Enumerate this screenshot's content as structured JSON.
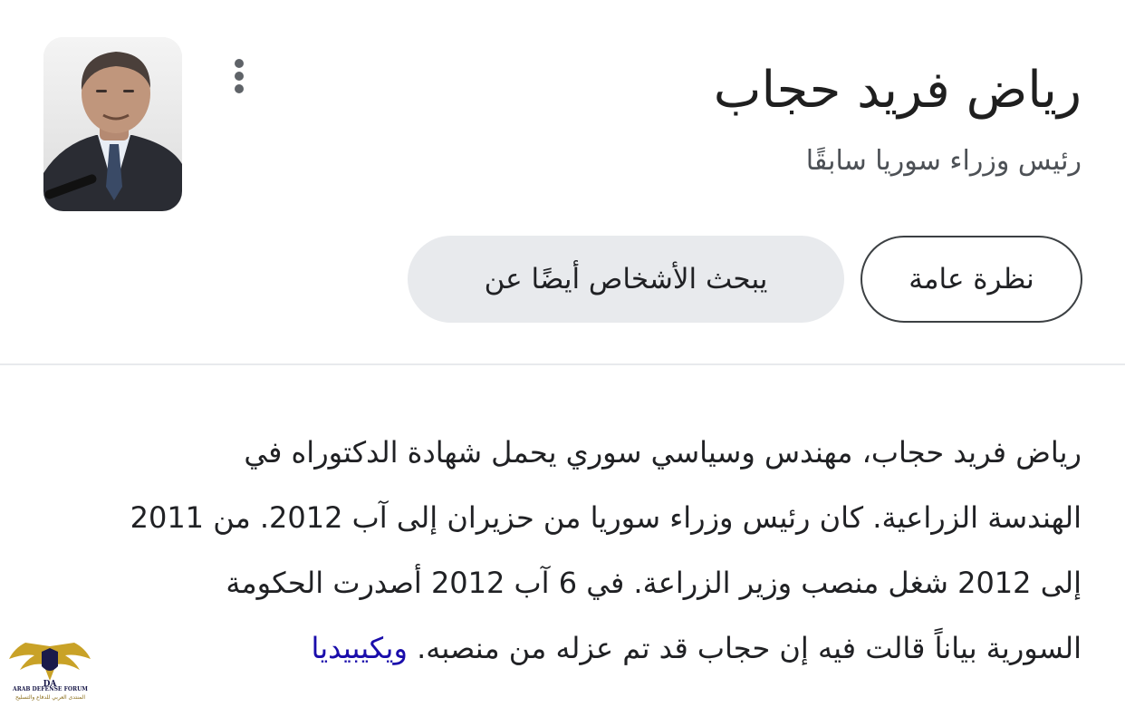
{
  "header": {
    "title": "رياض فريد حجاب",
    "subtitle": "رئيس وزراء سوريا سابقًا"
  },
  "tabs": [
    {
      "label": "نظرة عامة",
      "selected": true
    },
    {
      "label": "يبحث الأشخاص أيضًا عن",
      "selected": false
    }
  ],
  "description": {
    "lines": [
      "رياض فريد حجاب، مهندس وسياسي سوري يحمل شهادة الدكتوراه في",
      "الهندسة الزراعية. كان رئيس وزراء سوريا من حزيران إلى آب 2012. من 2011",
      "إلى 2012 شغل منصب وزير الزراعة. في 6 آب 2012 أصدرت الحكومة",
      "السورية بياناً قالت فيه إن حجاب قد تم عزله من منصبه."
    ],
    "source_link": "ويكيبيديا"
  },
  "watermark": {
    "abbr": "DA",
    "name": "ARAB DEFENSE FORUM",
    "arabic": "المنتدى العربي للدفاع والتسليح"
  },
  "icons": {
    "menu": "more-vert-icon",
    "photo": "person-photo"
  },
  "colors": {
    "link": "#1a0dab",
    "chip_bg": "#e8eaed",
    "chip_border": "#3c4043"
  }
}
